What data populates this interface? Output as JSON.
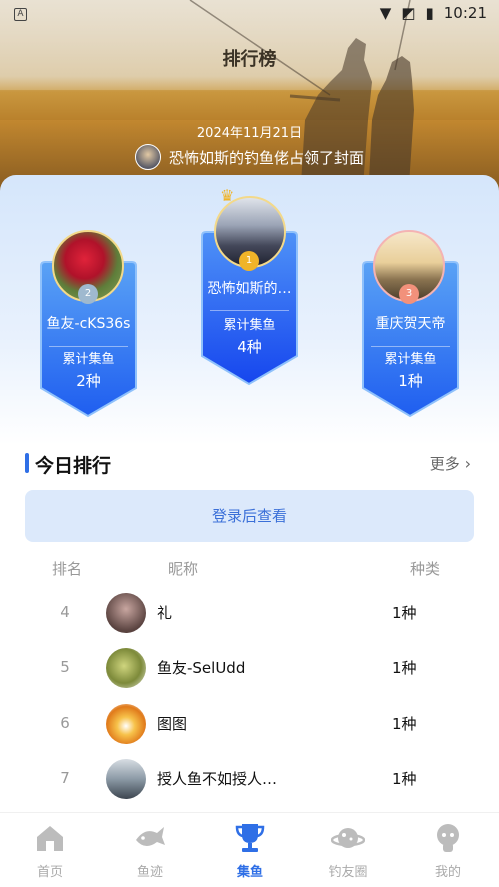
{
  "status_bar": {
    "time": "10:21",
    "indicator": "A"
  },
  "header": {
    "title": "排行榜",
    "cover_date": "2024年11月21日",
    "cover_text": "恐怖如斯的钓鱼佬占领了封面"
  },
  "podium": {
    "total_label": "累计集鱼",
    "first": {
      "rank": "1",
      "name": "恐怖如斯的…",
      "count": "4种"
    },
    "second": {
      "rank": "2",
      "name": "鱼友-cKS36s",
      "count": "2种"
    },
    "third": {
      "rank": "3",
      "name": "重庆贺天帝",
      "count": "1种"
    }
  },
  "today": {
    "title": "今日排行",
    "more": "更多",
    "login_prompt": "登录后查看",
    "columns": {
      "rank": "排名",
      "nickname": "昵称",
      "species": "种类"
    },
    "rows": [
      {
        "rank": "4",
        "name": "礼",
        "count": "1种"
      },
      {
        "rank": "5",
        "name": "鱼友-SelUdd",
        "count": "1种"
      },
      {
        "rank": "6",
        "name": "图图",
        "count": "1种"
      },
      {
        "rank": "7",
        "name": "授人鱼不如授人…",
        "count": "1种"
      }
    ]
  },
  "tabs": [
    {
      "label": "首页",
      "icon": "home-icon"
    },
    {
      "label": "鱼迹",
      "icon": "fish-trace-icon"
    },
    {
      "label": "集鱼",
      "icon": "trophy-icon"
    },
    {
      "label": "钓友圈",
      "icon": "planet-icon"
    },
    {
      "label": "我的",
      "icon": "profile-icon"
    }
  ],
  "colors": {
    "accent": "#2f6fe6",
    "badge_blue": "#1f5ef0",
    "gold": "#f0b429"
  }
}
